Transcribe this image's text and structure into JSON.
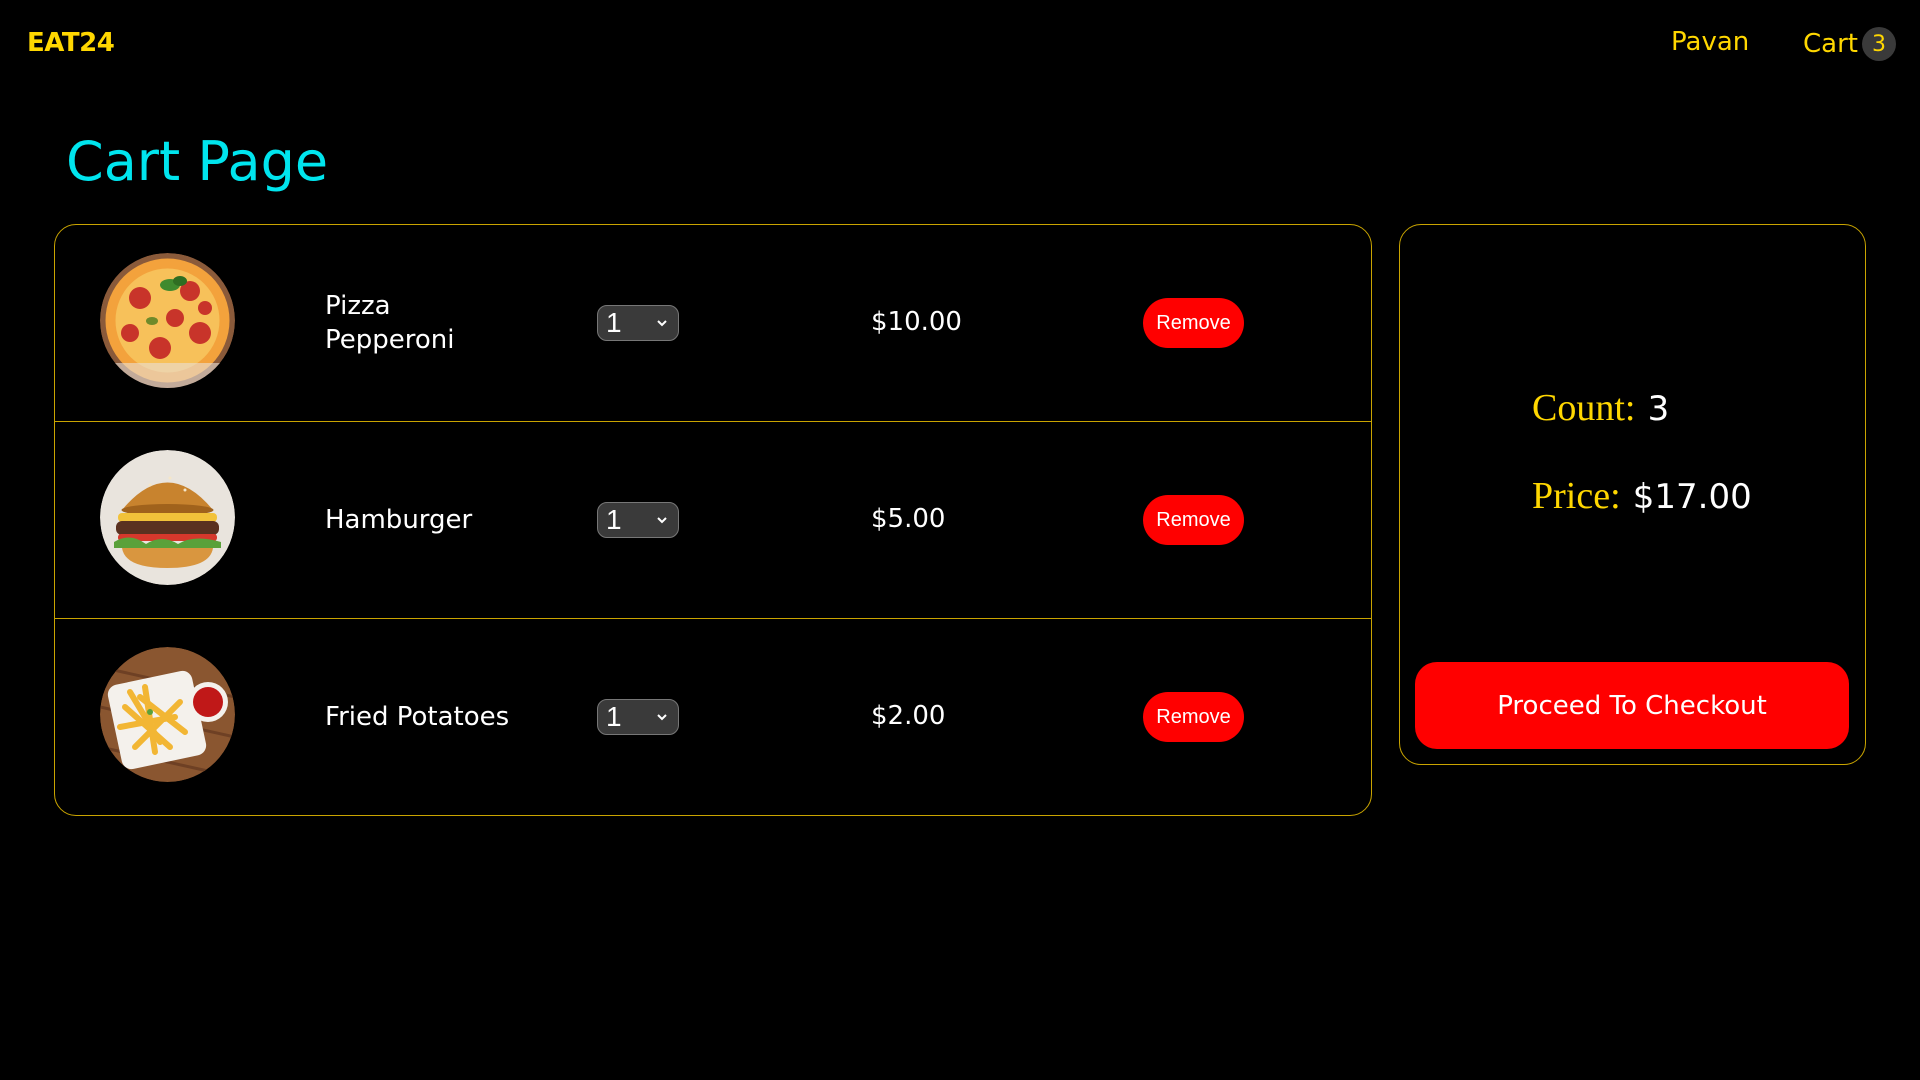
{
  "header": {
    "brand": "EAT24",
    "user_name": "Pavan",
    "cart_label": "Cart",
    "cart_count": "3"
  },
  "page": {
    "title": "Cart Page"
  },
  "items": [
    {
      "name": "Pizza Pepperoni",
      "quantity": "1",
      "price": "$10.00",
      "remove_label": "Remove",
      "image": "pizza-pepperoni-photo"
    },
    {
      "name": "Hamburger",
      "quantity": "1",
      "price": "$5.00",
      "remove_label": "Remove",
      "image": "hamburger-photo"
    },
    {
      "name": "Fried Potatoes",
      "quantity": "1",
      "price": "$2.00",
      "remove_label": "Remove",
      "image": "fried-potatoes-photo"
    }
  ],
  "summary": {
    "count_label": "Count:",
    "count_value": "3",
    "price_label": "Price:",
    "price_value": "$17.00",
    "checkout_label": "Proceed To Checkout"
  },
  "colors": {
    "background": "#000000",
    "brand": "#ffd700",
    "title": "#00e5ee",
    "border": "#c9a400",
    "button": "#ff0000",
    "text": "#ffffff"
  }
}
